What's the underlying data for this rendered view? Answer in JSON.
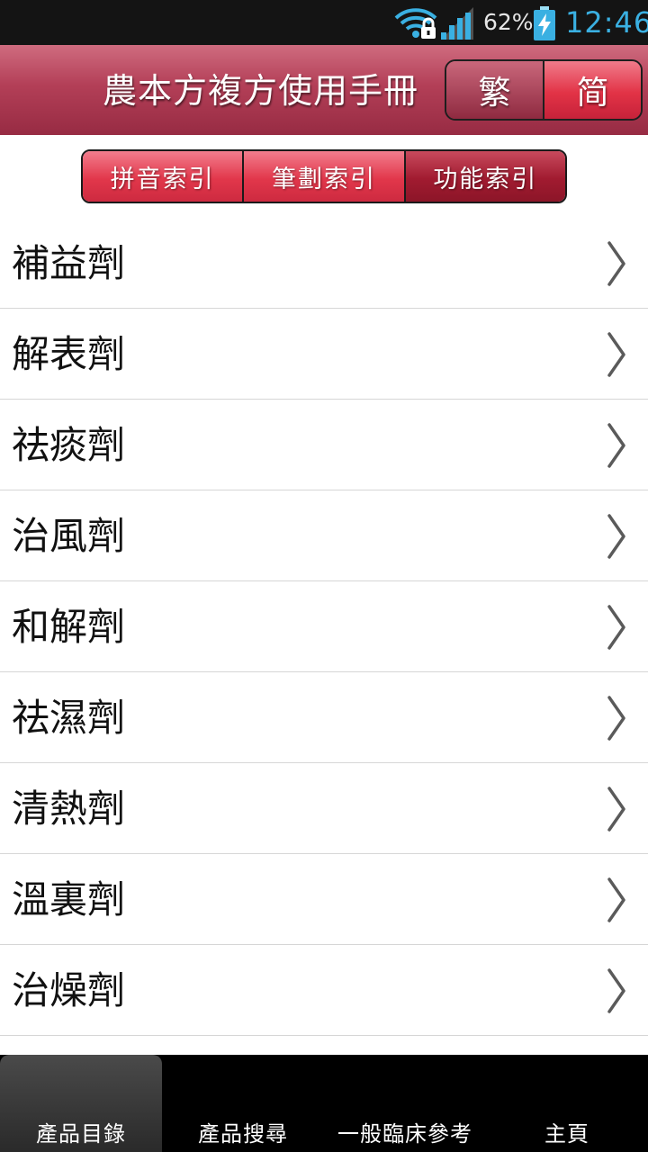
{
  "status_bar": {
    "battery_percent": "62%",
    "time": "12:46",
    "icons": [
      "wifi-lock-icon",
      "signal-icon",
      "battery-charging-icon"
    ]
  },
  "header": {
    "title": "農本方複方使用手冊",
    "lang_traditional": "繁",
    "lang_simplified": "简"
  },
  "index_tabs": [
    {
      "label": "拼音索引"
    },
    {
      "label": "筆劃索引"
    },
    {
      "label": "功能索引"
    }
  ],
  "active_index_tab": "功能索引",
  "categories": [
    {
      "label": "補益劑"
    },
    {
      "label": "解表劑"
    },
    {
      "label": "祛痰劑"
    },
    {
      "label": "治風劑"
    },
    {
      "label": "和解劑"
    },
    {
      "label": "祛濕劑"
    },
    {
      "label": "清熱劑"
    },
    {
      "label": "溫裏劑"
    },
    {
      "label": "治燥劑"
    }
  ],
  "tab_bar": [
    {
      "label": "產品目錄"
    },
    {
      "label": "產品搜尋"
    },
    {
      "label": "一般臨床參考"
    },
    {
      "label": "主頁"
    }
  ],
  "selected_tab": "產品目錄",
  "colors": {
    "header_top": "#cf6c7f",
    "header_bottom": "#972b43",
    "button_red": "#e2374b",
    "active_dark_red": "#a11b30",
    "clock_blue": "#3ab0e2"
  }
}
